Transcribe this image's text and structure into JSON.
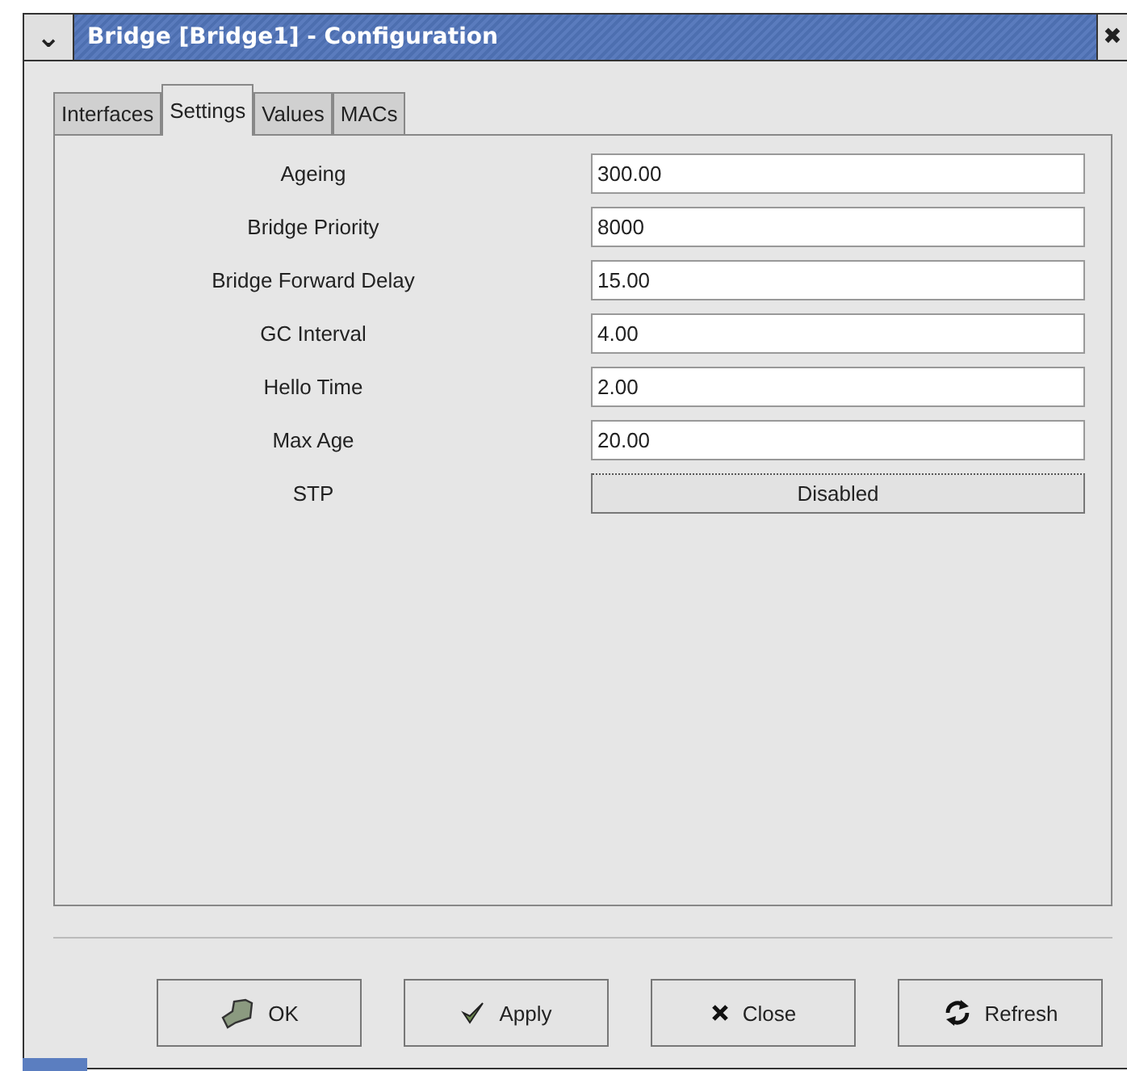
{
  "window": {
    "title": "Bridge [Bridge1] - Configuration",
    "menu_glyph": "⌄",
    "close_glyph": "✖"
  },
  "tabs": [
    {
      "label": "Interfaces",
      "selected": false
    },
    {
      "label": "Settings",
      "selected": true
    },
    {
      "label": "Values",
      "selected": false
    },
    {
      "label": "MACs",
      "selected": false
    }
  ],
  "fields": [
    {
      "kind": "text",
      "label": "Ageing",
      "value": "300.00"
    },
    {
      "kind": "text",
      "label": "Bridge Priority",
      "value": "8000"
    },
    {
      "kind": "text",
      "label": "Bridge Forward Delay",
      "value": "15.00"
    },
    {
      "kind": "text",
      "label": "GC Interval",
      "value": "4.00"
    },
    {
      "kind": "text",
      "label": "Hello Time",
      "value": "2.00"
    },
    {
      "kind": "text",
      "label": "Max Age",
      "value": "20.00"
    },
    {
      "kind": "toggle",
      "label": "STP",
      "value": "Disabled"
    }
  ],
  "buttons": [
    {
      "kind": "ok",
      "label": "OK"
    },
    {
      "kind": "apply",
      "label": "Apply"
    },
    {
      "kind": "close",
      "label": "Close"
    },
    {
      "kind": "refresh",
      "label": "Refresh"
    }
  ]
}
